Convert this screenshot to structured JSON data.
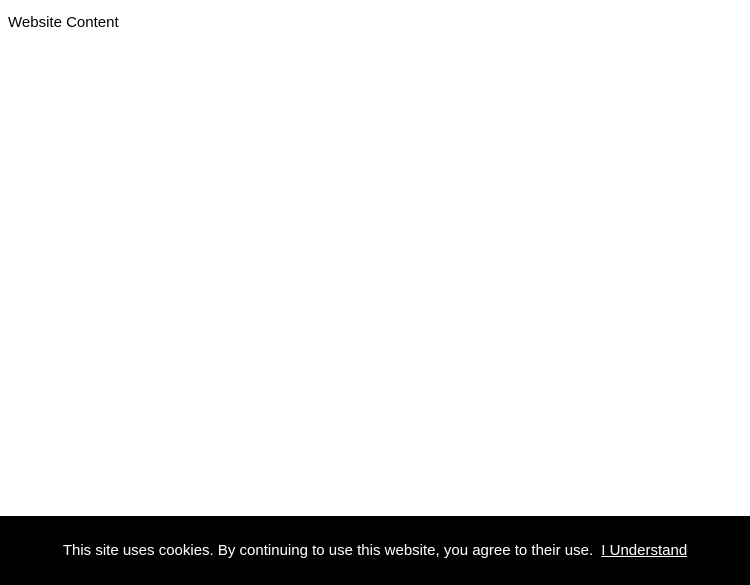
{
  "main": {
    "content_label": "Website Content"
  },
  "cookie_banner": {
    "message": "This site uses cookies. By continuing to use this website, you agree to their use.",
    "accept_label": "I Understand"
  }
}
